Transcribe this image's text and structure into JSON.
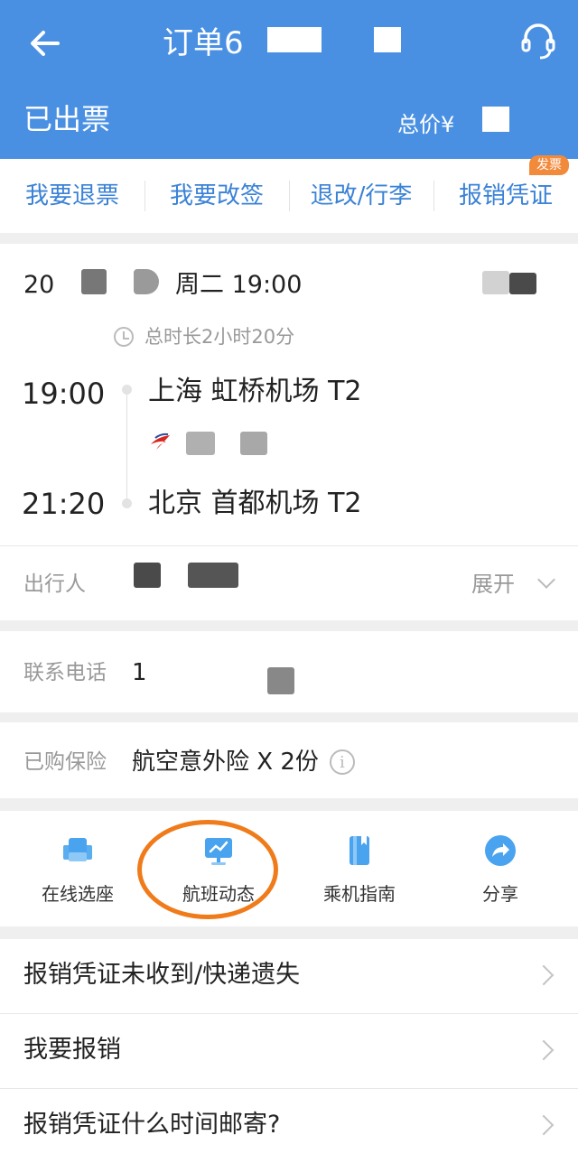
{
  "header": {
    "title_prefix": "订单6",
    "status": "已出票",
    "total_prefix": "总价¥"
  },
  "actions": [
    {
      "label": "我要退票"
    },
    {
      "label": "我要改签"
    },
    {
      "label": "退改/行李"
    },
    {
      "label": "报销凭证",
      "badge": "发票"
    }
  ],
  "flight": {
    "date_prefix": "20",
    "weekday_time": "周二  19:00",
    "duration": "总时长2小时20分",
    "depart_time": "19:00",
    "depart_airport": "上海 虹桥机场 T2",
    "arrive_time": "21:20",
    "arrive_airport": "北京 首都机场 T2"
  },
  "traveler": {
    "label": "出行人",
    "expand": "展开"
  },
  "contact": {
    "label": "联系电话",
    "value_prefix": "1"
  },
  "insurance": {
    "label": "已购保险",
    "value": "航空意外险   X 2份",
    "info_glyph": "i"
  },
  "tools": [
    {
      "label": "在线选座",
      "icon": "seat-icon"
    },
    {
      "label": "航班动态",
      "icon": "flight-status-icon"
    },
    {
      "label": "乘机指南",
      "icon": "guide-book-icon"
    },
    {
      "label": "分享",
      "icon": "share-icon"
    }
  ],
  "links": [
    {
      "label": "报销凭证未收到/快递遗失"
    },
    {
      "label": "我要报销"
    },
    {
      "label": "报销凭证什么时间邮寄?"
    }
  ],
  "colors": {
    "header": "#4a90e2",
    "action_text": "#3a82d6",
    "badge": "#f28a3c",
    "highlight_circle": "#f07b1a"
  }
}
